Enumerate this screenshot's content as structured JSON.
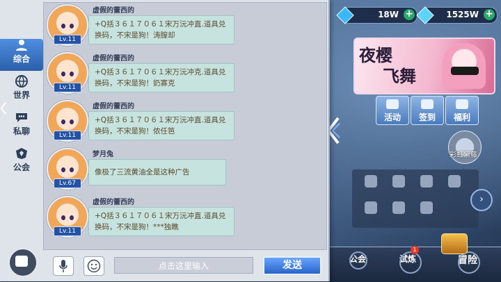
{
  "currency": [
    {
      "icon": "blue-gem-icon",
      "value": "18W"
    },
    {
      "icon": "diamond-icon",
      "value": "1525W"
    }
  ],
  "banner": {
    "title_line1": "夜樱",
    "title_line2": "飞舞"
  },
  "activity_buttons": [
    {
      "label": "活动",
      "icon": "activity-icon"
    },
    {
      "label": "签到",
      "icon": "signin-icon"
    },
    {
      "label": "福利",
      "icon": "gift-icon"
    }
  ],
  "mascot_label": "彩虹紫藤",
  "bottom_nav": [
    {
      "label": "公会",
      "icon": "guild-icon"
    },
    {
      "label": "试炼",
      "icon": "trial-icon",
      "badge": "1"
    },
    {
      "label": "冒险",
      "icon": "adventure-icon"
    }
  ],
  "chat_tabs": [
    {
      "label": "综合",
      "icon": "people-icon",
      "active": true
    },
    {
      "label": "世界",
      "icon": "globe-icon",
      "active": false
    },
    {
      "label": "私聊",
      "icon": "speech-icon",
      "active": false
    },
    {
      "label": "公会",
      "icon": "guild-emblem-icon",
      "active": false
    }
  ],
  "messages": [
    {
      "sender": "虚假的蕾西的",
      "level": "Lv.11",
      "text": "+Q括３６１７０６１宋万沅冲直.道具兑换码，不宋是狗！涛膣却"
    },
    {
      "sender": "虚假的蕾西的",
      "level": "Lv.11",
      "text": "+Q括３６１７０６１宋万沅冲克.道具兑换码，不宋是狗！奶寡克"
    },
    {
      "sender": "虚假的蕾西的",
      "level": "Lv.11",
      "text": "+Q括３６１７０６１宋万沅冲直.道具兑换码，不宋是狗！侬任笆"
    },
    {
      "sender": "梦月兔",
      "level": "Lv.67",
      "text": "像极了三流黄油全是这种广告"
    },
    {
      "sender": "虚假的蕾西的",
      "level": "Lv.11",
      "text": "+Q括３６１７０６１宋万沅冲直.道具兑换码，不宋是狗！***独瞧"
    }
  ],
  "input": {
    "placeholder": "点击这里输入"
  },
  "send_label": "发送"
}
